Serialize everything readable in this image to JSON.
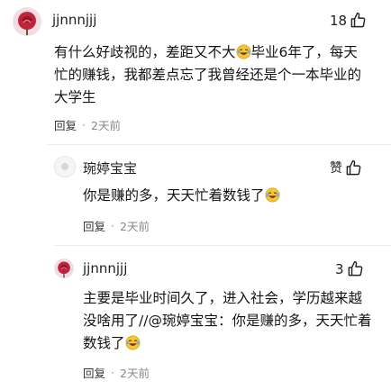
{
  "comments": [
    {
      "username": "jjnnnjjj",
      "likes": "18",
      "text_before": "有什么好歧视的，差距又不大",
      "text_after": "毕业6年了，每天忙的赚钱，我都差点忘了我曾经还是个一本毕业的大学生",
      "reply_label": "回复",
      "time": "2天前"
    },
    {
      "username": "琬婷宝宝",
      "likes": "赞",
      "text": "你是赚的多，天天忙着数钱了",
      "reply_label": "回复",
      "time": "2天前"
    },
    {
      "username": "jjnnnjjj",
      "likes": "3",
      "text": "主要是毕业时间久了，进入社会，学历越来越没啥用了//@琬婷宝宝：你是赚的多，天天忙着数钱了",
      "reply_label": "回复",
      "time": "2天前"
    }
  ],
  "separator": "·",
  "icons": {
    "like": "thumbs-up-icon",
    "laugh": "laughing-emoji-icon"
  },
  "colors": {
    "avatar_red": "#c0243a",
    "text": "#141414",
    "meta": "#8a8a8a"
  }
}
